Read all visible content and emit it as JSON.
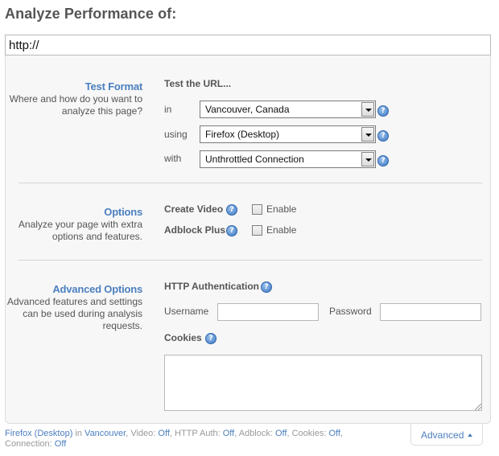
{
  "page": {
    "title": "Analyze Performance of:"
  },
  "url_field": {
    "value": "http://"
  },
  "test_format": {
    "title": "Test Format",
    "description": "Where and how do you want to analyze this page?",
    "heading": "Test the URL...",
    "rows": [
      {
        "label": "in",
        "value": "Vancouver, Canada"
      },
      {
        "label": "using",
        "value": "Firefox (Desktop)"
      },
      {
        "label": "with",
        "value": "Unthrottled Connection"
      }
    ]
  },
  "options": {
    "title": "Options",
    "description": "Analyze your page with extra options and features.",
    "create_video": {
      "label": "Create Video",
      "checkbox_label": "Enable"
    },
    "adblock_plus": {
      "label": "Adblock Plus",
      "checkbox_label": "Enable"
    }
  },
  "advanced_options": {
    "title": "Advanced Options",
    "description": "Advanced features and settings can be used during analysis requests.",
    "http_auth": {
      "label": "HTTP Authentication"
    },
    "username": {
      "label": "Username",
      "value": ""
    },
    "password": {
      "label": "Password",
      "value": ""
    },
    "cookies": {
      "label": "Cookies",
      "value": ""
    }
  },
  "summary": {
    "browser": "Firefox (Desktop)",
    "in_word": "in",
    "location": "Vancouver",
    "video_label": "Video:",
    "video_value": "Off",
    "http_auth_label": "HTTP Auth:",
    "http_auth_value": "Off",
    "adblock_label": "Adblock:",
    "adblock_value": "Off",
    "cookies_label": "Cookies:",
    "cookies_value": "Off",
    "connection_label": "Connection:",
    "connection_value": "Off"
  },
  "advanced_tab": {
    "label": "Advanced"
  },
  "colors": {
    "accent": "#4b7fbf",
    "panel_bg": "#f7f7f7",
    "text": "#555555"
  },
  "icons": {
    "help": "help-icon",
    "select_arrow": "chevron-down-icon",
    "collapse": "caret-up-icon"
  }
}
